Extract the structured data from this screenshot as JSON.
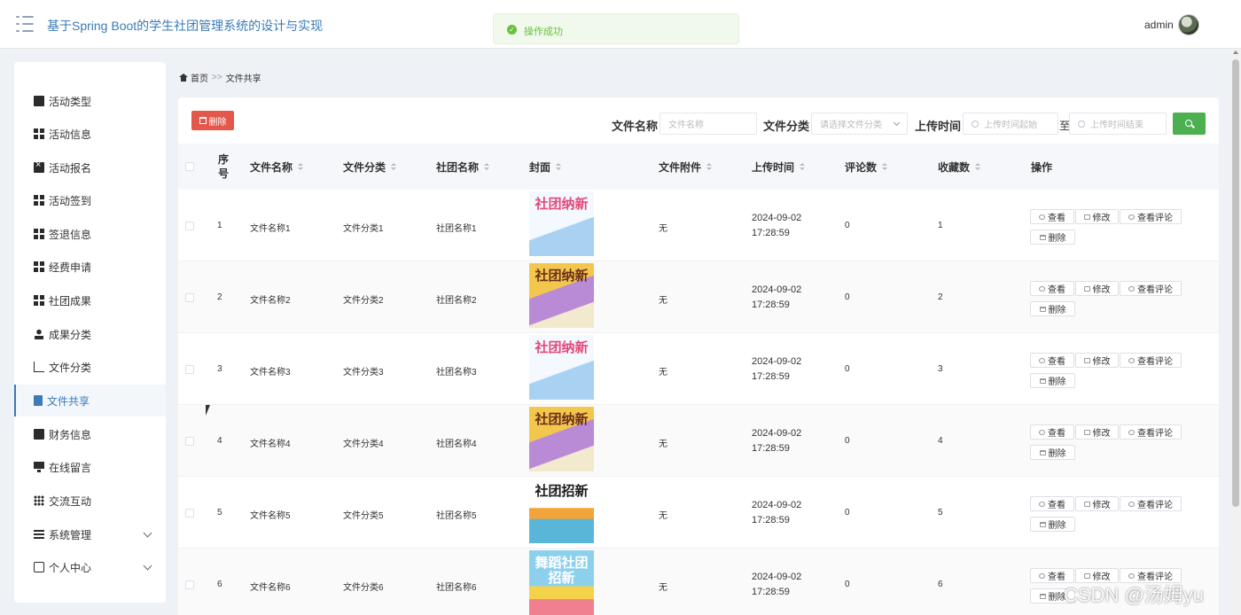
{
  "header": {
    "title": "基于Spring Boot的学生社团管理系统的设计与实现",
    "toast": "操作成功",
    "user": "admin"
  },
  "sidebar": {
    "items": [
      {
        "label": "活动类型",
        "icon": "folder-icon"
      },
      {
        "label": "活动信息",
        "icon": "grid-icon"
      },
      {
        "label": "活动报名",
        "icon": "close-box-icon"
      },
      {
        "label": "活动签到",
        "icon": "grid-icon"
      },
      {
        "label": "签退信息",
        "icon": "grid-icon"
      },
      {
        "label": "经费申请",
        "icon": "grid-icon"
      },
      {
        "label": "社团成果",
        "icon": "grid-icon"
      },
      {
        "label": "成果分类",
        "icon": "user-icon"
      },
      {
        "label": "文件分类",
        "icon": "chart-icon"
      },
      {
        "label": "文件共享",
        "icon": "clipboard-icon",
        "active": true
      },
      {
        "label": "财务信息",
        "icon": "money-icon"
      },
      {
        "label": "在线留言",
        "icon": "monitor-icon"
      },
      {
        "label": "交流互动",
        "icon": "apps-icon"
      },
      {
        "label": "系统管理",
        "icon": "list-icon",
        "expandable": true
      },
      {
        "label": "个人中心",
        "icon": "id-card-icon",
        "expandable": true
      }
    ]
  },
  "breadcrumb": {
    "home": "首页",
    "separator": ">>",
    "current": "文件共享"
  },
  "toolbar": {
    "delete_label": "删除"
  },
  "filters": {
    "name_label": "文件名称",
    "name_placeholder": "文件名称",
    "category_label": "文件分类",
    "category_placeholder": "请选择文件分类",
    "time_label": "上传时间",
    "time_start_placeholder": "上传时间起始",
    "time_sep": "至",
    "time_end_placeholder": "上传时间结束"
  },
  "table": {
    "columns": [
      "序号",
      "文件名称",
      "文件分类",
      "社团名称",
      "封面",
      "文件附件",
      "上传时间",
      "评论数",
      "收藏数",
      "操作"
    ],
    "rows": [
      {
        "index": "1",
        "name": "文件名称1",
        "category": "文件分类1",
        "club": "社团名称1",
        "attachment": "无",
        "time": "2024-09-02 17:28:59",
        "comments": "0",
        "favorites": "1",
        "cover_text": "社团纳新"
      },
      {
        "index": "2",
        "name": "文件名称2",
        "category": "文件分类2",
        "club": "社团名称2",
        "attachment": "无",
        "time": "2024-09-02 17:28:59",
        "comments": "0",
        "favorites": "2",
        "cover_text": "社团纳新"
      },
      {
        "index": "3",
        "name": "文件名称3",
        "category": "文件分类3",
        "club": "社团名称3",
        "attachment": "无",
        "time": "2024-09-02 17:28:59",
        "comments": "0",
        "favorites": "3",
        "cover_text": "社团纳新"
      },
      {
        "index": "4",
        "name": "文件名称4",
        "category": "文件分类4",
        "club": "社团名称4",
        "attachment": "无",
        "time": "2024-09-02 17:28:59",
        "comments": "0",
        "favorites": "4",
        "cover_text": "社团纳新"
      },
      {
        "index": "5",
        "name": "文件名称5",
        "category": "文件分类5",
        "club": "社团名称5",
        "attachment": "无",
        "time": "2024-09-02 17:28:59",
        "comments": "0",
        "favorites": "5",
        "cover_text": "社团招新"
      },
      {
        "index": "6",
        "name": "文件名称6",
        "category": "文件分类6",
        "club": "社团名称6",
        "attachment": "无",
        "time": "2024-09-02 17:28:59",
        "comments": "0",
        "favorites": "6",
        "cover_text": "舞蹈社团 招新"
      }
    ],
    "actions": {
      "view": "查看",
      "edit": "修改",
      "view_comments": "查看评论",
      "delete": "删除"
    }
  },
  "watermark": "CSDN @汤姆yu",
  "colors": {
    "primary": "#3a7bb8",
    "danger": "#e4574b",
    "success": "#4caf50",
    "toast_bg": "#f0f9eb"
  }
}
